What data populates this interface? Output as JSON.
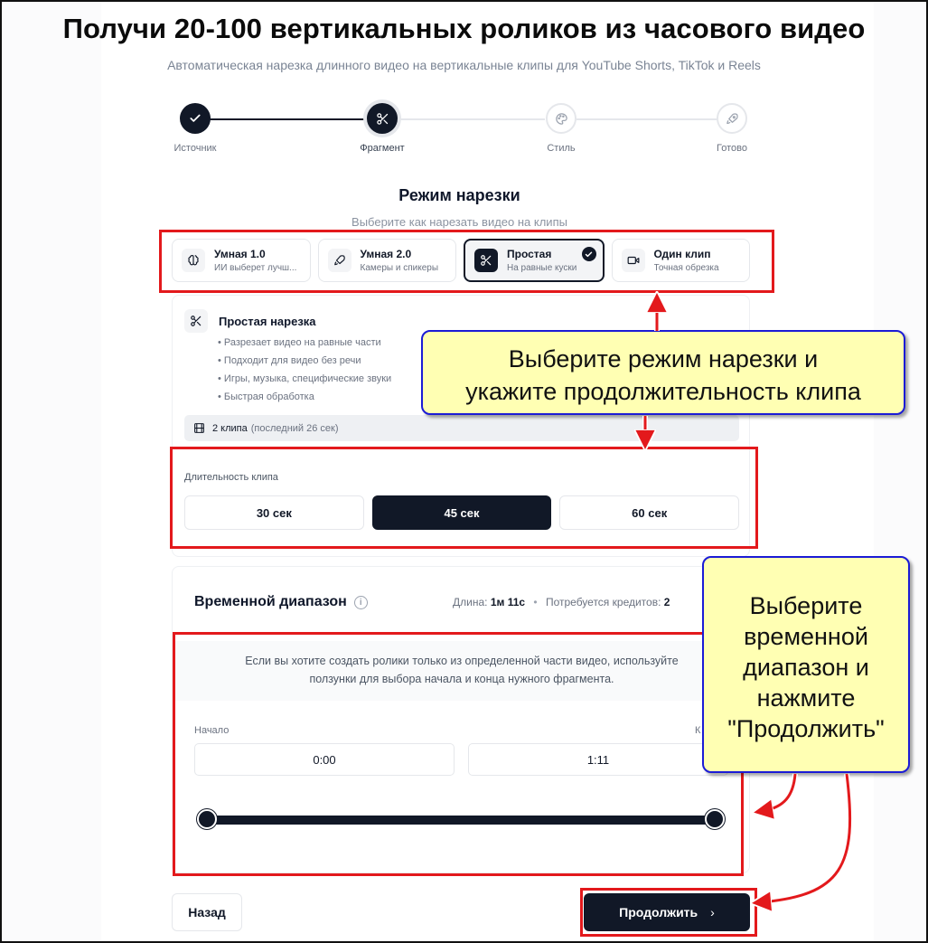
{
  "header": {
    "title": "Получи 20-100 вертикальных роликов из часового видео",
    "subtitle": "Автоматическая нарезка длинного видео на вертикальные клипы для YouTube Shorts, TikTok и Reels"
  },
  "stepper": {
    "steps": [
      {
        "label": "Источник",
        "state": "done",
        "icon": "check-icon"
      },
      {
        "label": "Фрагмент",
        "state": "active",
        "icon": "scissors-icon"
      },
      {
        "label": "Стиль",
        "state": "todo",
        "icon": "palette-icon"
      },
      {
        "label": "Готово",
        "state": "todo",
        "icon": "rocket-icon"
      }
    ]
  },
  "mode": {
    "title": "Режим нарезки",
    "subtitle": "Выберите как нарезать видео на клипы",
    "options": [
      {
        "title": "Умная 1.0",
        "desc": "ИИ выберет лучш...",
        "icon": "brain-icon"
      },
      {
        "title": "Умная 2.0",
        "desc": "Камеры и спикеры",
        "icon": "rocket-icon"
      },
      {
        "title": "Простая",
        "desc": "На равные куски",
        "icon": "scissors-icon",
        "selected": true
      },
      {
        "title": "Один клип",
        "desc": "Точная обрезка",
        "icon": "video-camera-icon"
      }
    ]
  },
  "simple": {
    "title": "Простая нарезка",
    "bullets": [
      "• Разрезает видео на равные части",
      "• Подходит для видео без речи",
      "• Игры, музыка, специфические звуки",
      "• Быстрая обработка"
    ],
    "clips_count": "2 клипа",
    "clips_note": "(последний 26 сек)"
  },
  "duration": {
    "label": "Длительность клипа",
    "options": [
      "30 сек",
      "45 сек",
      "60 сек"
    ],
    "selected": "45 сек"
  },
  "range": {
    "title": "Временной диапазон",
    "length_label": "Длина:",
    "length_value": "1м 11с",
    "credits_label": "Потребуется кредитов:",
    "credits_value": "2",
    "hint_line1": "Если вы хотите создать ролики только из определенной части видео, используйте",
    "hint_line2": "ползунки для выбора начала и конца нужного фрагмента.",
    "start_label": "Начало",
    "end_label": "К",
    "start_value": "0:00",
    "end_value": "1:11"
  },
  "actions": {
    "back": "Назад",
    "next": "Продолжить",
    "next_icon": "chevron-right-icon"
  },
  "annotations": {
    "callout1_line1": "Выберите режим нарезки и",
    "callout1_line2": "укажите продолжительность клипа",
    "callout2_line1": "Выберите",
    "callout2_line2": "временной",
    "callout2_line3": "диапазон и",
    "callout2_line4": "нажмите",
    "callout2_line5": "\"Продолжить\"",
    "box_color": "#e3191c",
    "callout_bg": "#ffffb3",
    "callout_border": "#1b1bd6"
  },
  "colors": {
    "primary": "#111827",
    "muted": "#6b7280",
    "border": "#e5e7eb"
  }
}
